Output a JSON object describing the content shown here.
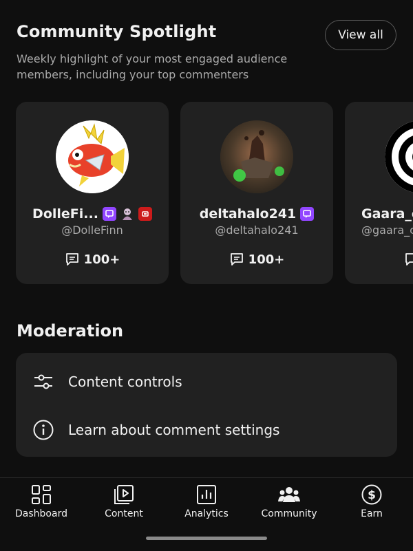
{
  "spotlight": {
    "title": "Community Spotlight",
    "view_all_label": "View all",
    "subtitle": "Weekly highlight of your most engaged audience members, including your top commenters",
    "cards": [
      {
        "name": "DolleFi...",
        "handle": "@DolleFinn",
        "count": "100+",
        "badges": [
          "purple-chat",
          "avatar-image",
          "red-square"
        ]
      },
      {
        "name": "deltahalo241",
        "handle": "@deltahalo241",
        "count": "100+",
        "badges": [
          "purple-chat"
        ]
      },
      {
        "name": "Gaara_c",
        "handle": "@gaara_c",
        "count": "",
        "badges": []
      }
    ]
  },
  "moderation": {
    "title": "Moderation",
    "items": [
      {
        "label": "Content controls",
        "icon": "sliders-icon"
      },
      {
        "label": "Learn about comment settings",
        "icon": "info-icon"
      }
    ]
  },
  "tabs": [
    {
      "label": "Dashboard",
      "icon": "dashboard-icon"
    },
    {
      "label": "Content",
      "icon": "content-icon"
    },
    {
      "label": "Analytics",
      "icon": "analytics-icon"
    },
    {
      "label": "Community",
      "icon": "community-icon"
    },
    {
      "label": "Earn",
      "icon": "earn-icon"
    }
  ],
  "colors": {
    "background": "#0f0f0f",
    "card": "#212121",
    "badge_purple": "#9146ff",
    "badge_red": "#cc1b1b"
  }
}
